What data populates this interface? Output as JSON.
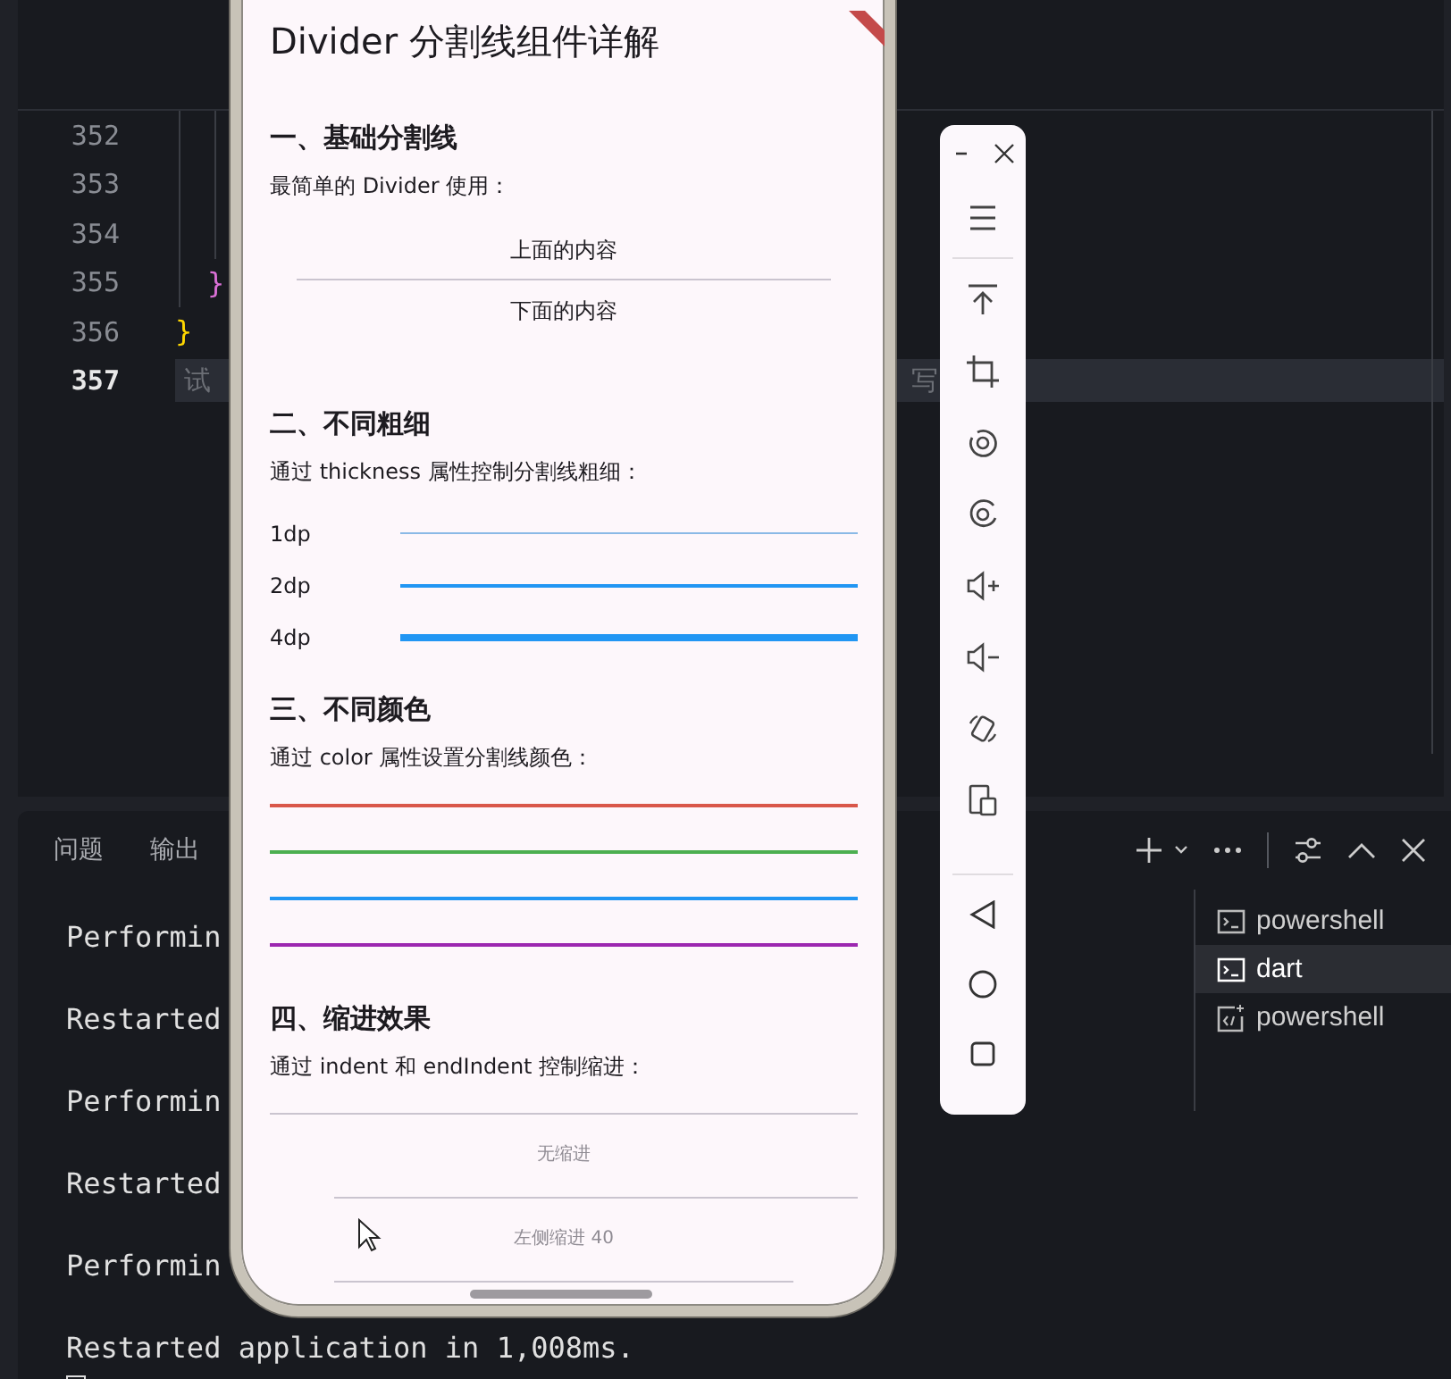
{
  "editor": {
    "lines": [
      {
        "number": "352",
        "current": false
      },
      {
        "number": "353",
        "current": false
      },
      {
        "number": "354",
        "current": false
      },
      {
        "number": "355",
        "code": "}",
        "color": "#da70d6",
        "current": false
      },
      {
        "number": "356",
        "code": "}",
        "color": "#ffd700",
        "current": false
      },
      {
        "number": "357",
        "current": true
      }
    ],
    "hint_parts": [
      "试",
      "写"
    ]
  },
  "panel": {
    "tabs": [
      {
        "label": "问题",
        "selected": false
      },
      {
        "label": "输出",
        "selected": false
      }
    ],
    "terminal_lines": [
      "Performin",
      "Restarted",
      "Performin",
      "Restarted",
      "Performin",
      "Restarted application in 1,008ms."
    ],
    "sessions": [
      {
        "name": "powershell",
        "kind": "shell",
        "selected": false
      },
      {
        "name": "dart",
        "kind": "shell",
        "selected": true
      },
      {
        "name": "powershell",
        "kind": "task",
        "selected": false
      }
    ]
  },
  "phone": {
    "title": "Divider 分割线组件详解",
    "sections": [
      {
        "kind": "basic",
        "heading": "一、基础分割线",
        "description": "最简单的 Divider 使用：",
        "above": "上面的内容",
        "below": "下面的内容"
      },
      {
        "kind": "thickness",
        "heading": "二、不同粗细",
        "description": "通过 thickness 属性控制分割线粗细：",
        "rows": [
          {
            "label": "1dp",
            "kind": "thin"
          },
          {
            "label": "2dp",
            "kind": "medium"
          },
          {
            "label": "4dp",
            "kind": "thick"
          }
        ]
      },
      {
        "kind": "colors",
        "heading": "三、不同颜色",
        "description": "通过 color 属性设置分割线颜色：",
        "rows": [
          {
            "color": "#d9574a"
          },
          {
            "color": "#4caf50"
          },
          {
            "color": "#2196f3"
          },
          {
            "color": "#9c27b0"
          }
        ]
      },
      {
        "kind": "indent",
        "heading": "四、缩进效果",
        "description": "通过 indent 和 endIndent 控制缩进：",
        "items": [
          {
            "kind": "full_divider"
          },
          {
            "kind": "label",
            "text": "无缩进"
          },
          {
            "kind": "start_indented_divider"
          },
          {
            "kind": "label",
            "text": "左侧缩进 40"
          },
          {
            "kind": "both_indented_divider"
          }
        ]
      }
    ]
  }
}
